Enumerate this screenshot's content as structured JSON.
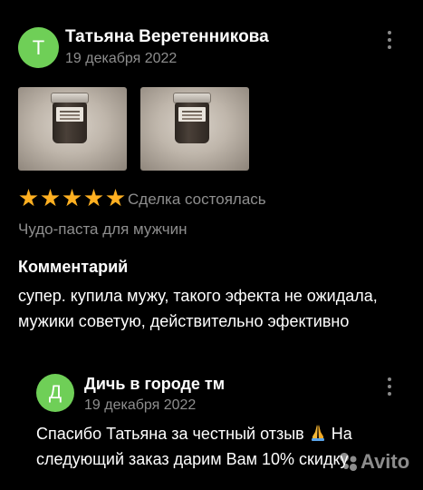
{
  "review": {
    "avatar_letter": "Т",
    "author": "Татьяна Веретенникова",
    "date": "19 декабря 2022",
    "photos": [
      "product-photo-1",
      "product-photo-2"
    ],
    "rating": 5,
    "deal_status": "Сделка состоялась",
    "product": "Чудо-паста для мужчин",
    "comment_heading": "Комментарий",
    "comment_text": "супер. купила мужу, такого эфекта не ожидала, мужики советую, действительно эфективно"
  },
  "reply": {
    "avatar_letter": "Д",
    "author": "Дичь в городе тм",
    "date": "19 декабря 2022",
    "text_before_emoji": "Спасибо Татьяна за честный отзыв ",
    "emoji": "folded-hands",
    "text_after_emoji": " На следующий заказ дарим Вам 10% скидку"
  },
  "watermark": {
    "text": "Avito"
  },
  "colors": {
    "background": "#000000",
    "avatar": "#6fcf57",
    "star": "#ffb021",
    "muted_text": "#8e8e8e"
  }
}
